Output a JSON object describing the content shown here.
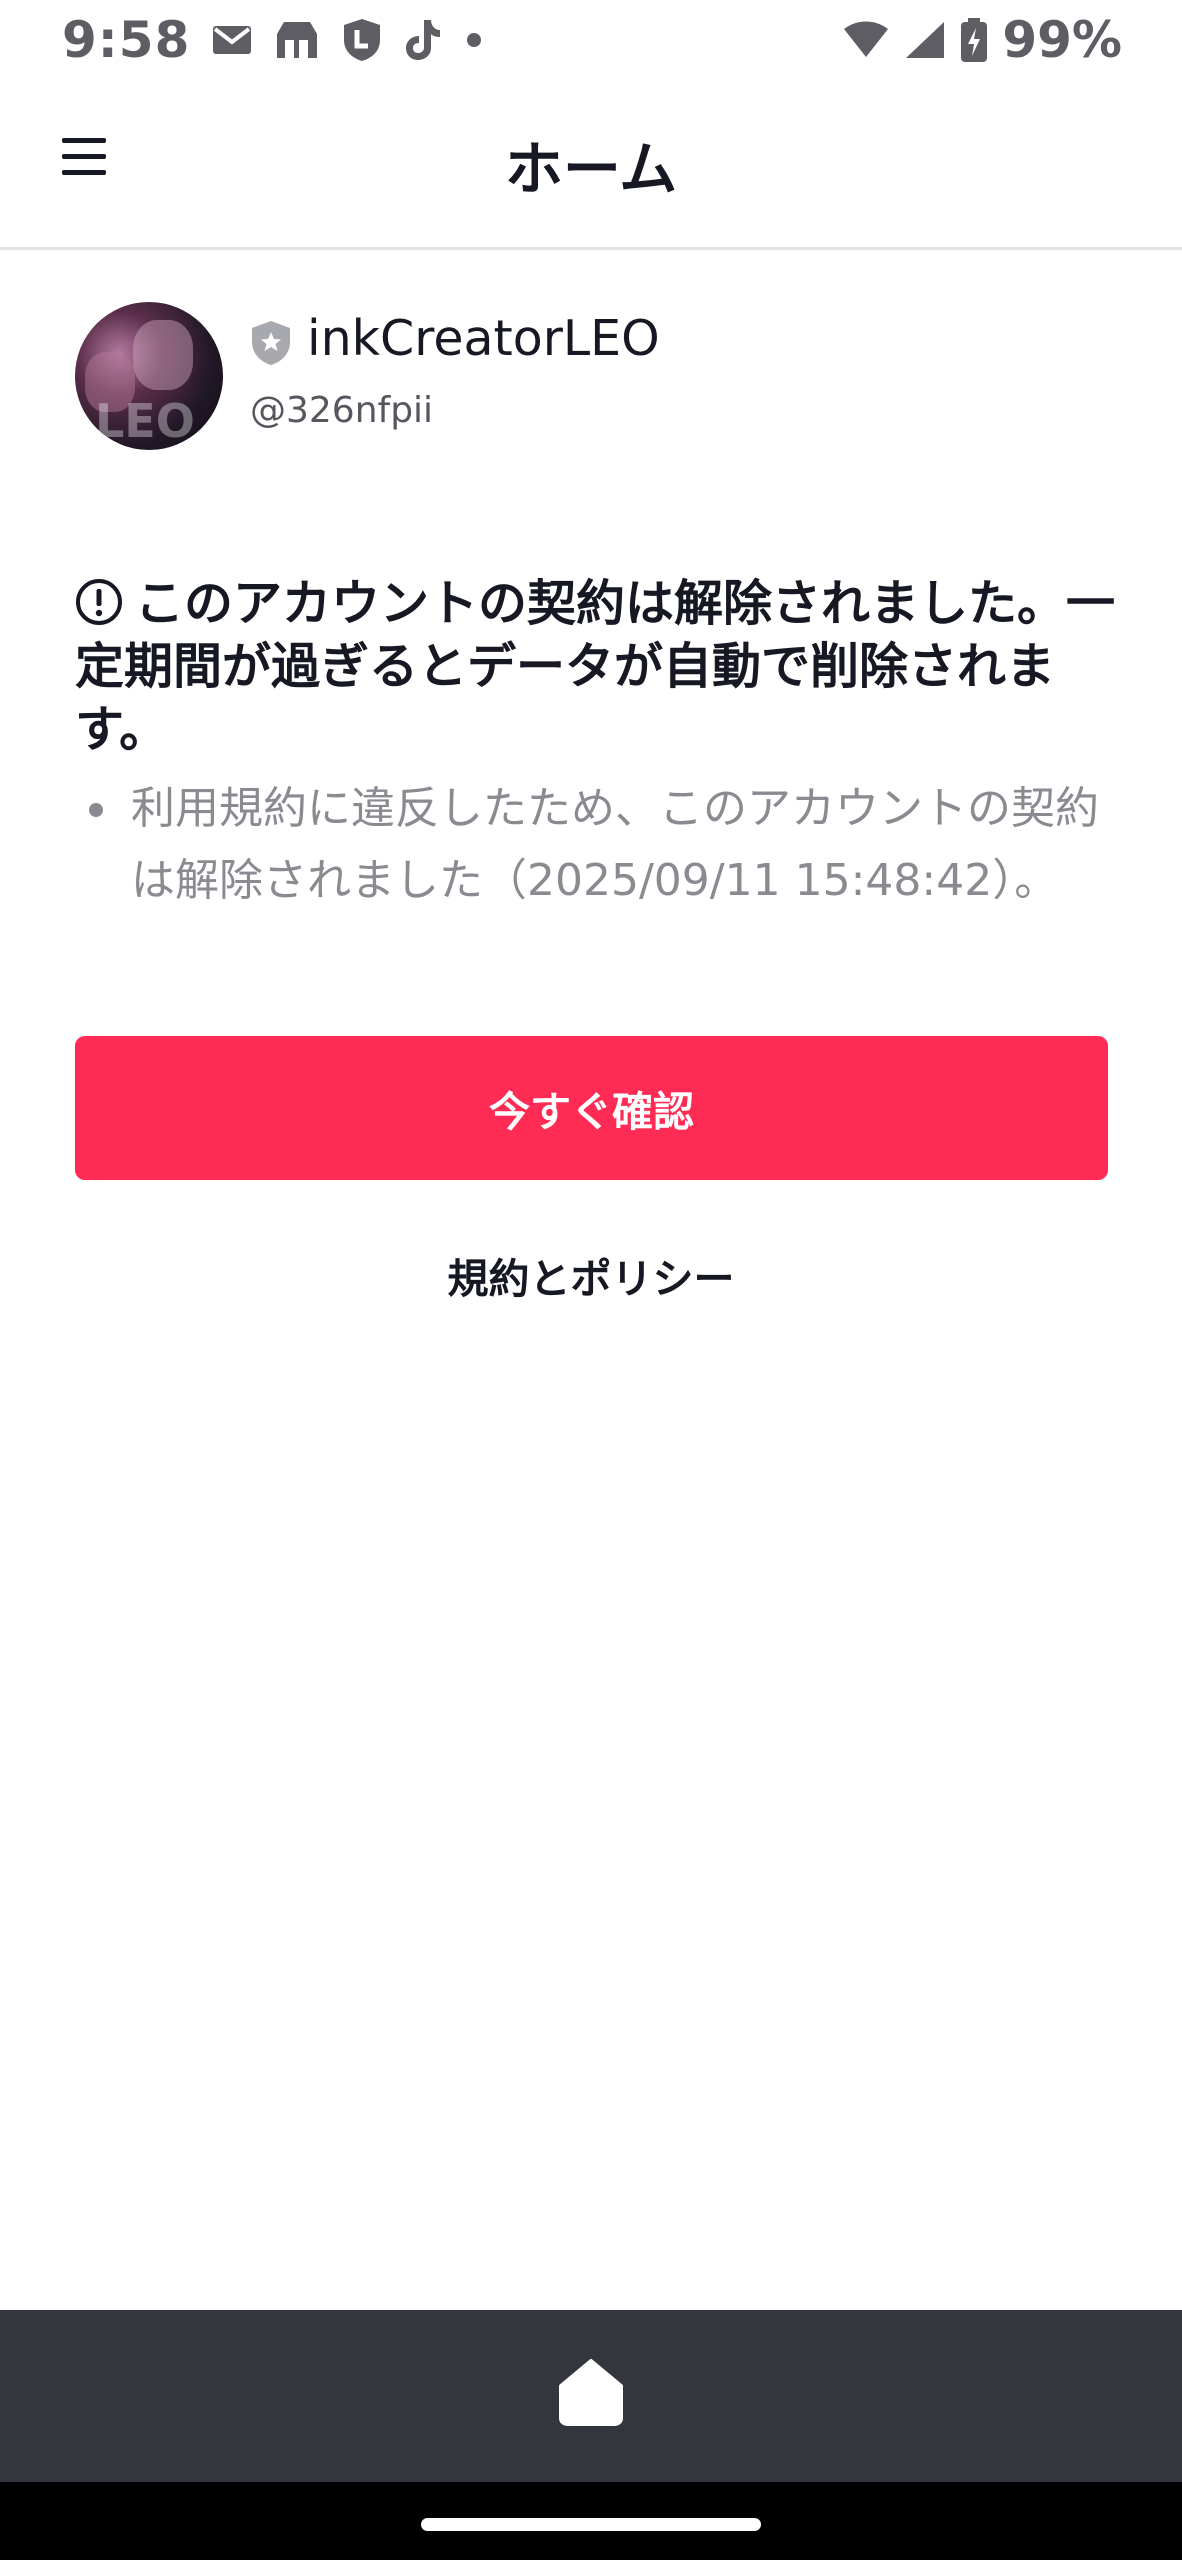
{
  "status_bar": {
    "time": "9:58",
    "notification_icons": [
      "mail-icon",
      "store-icon",
      "shield-app-icon",
      "tiktok-icon",
      "dot-icon"
    ],
    "battery_percent": "99%",
    "right_icons": [
      "wifi-icon",
      "signal-icon",
      "battery-charging-icon"
    ]
  },
  "header": {
    "title": "ホーム",
    "menu_icon": "hamburger-menu-icon"
  },
  "profile": {
    "avatar_text": "LEO",
    "badge_icon": "shield-star-icon",
    "username": "inkCreatorLEO",
    "handle": "@326nfpii"
  },
  "notice": {
    "title": "このアカウントの契約は解除されました。一定期間が過ぎるとデータが自動で削除されます。",
    "detail": "利用規約に違反したため、このアカウントの契約は解除されました（2025/09/11 15:48:42）。",
    "icon": "alert-circle-icon"
  },
  "actions": {
    "confirm_label": "今すぐ確認",
    "policy_label": "規約とポリシー"
  },
  "bottom_nav": {
    "home_icon": "home-icon"
  },
  "colors": {
    "accent": "#fe2c55",
    "bottom_bar": "#34363d",
    "text_primary": "#161823",
    "text_secondary": "#8a8b91"
  }
}
